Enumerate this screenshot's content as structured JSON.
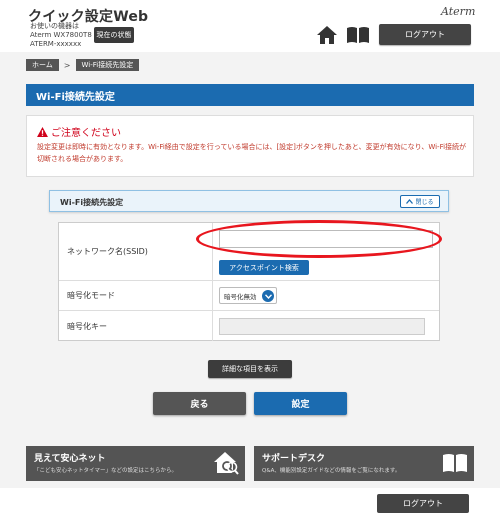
{
  "header": {
    "app_title": "クイック設定Web",
    "device_label": "お使いの機器は",
    "device_model": "Aterm WX7800T8",
    "device_id": "ATERM-xxxxxx",
    "status_button": "現在の状態",
    "brand": "Aterm",
    "logout_label": "ログアウト",
    "home_icon": "home-icon",
    "help_icon": "book-icon"
  },
  "breadcrumb": {
    "items": [
      "ホーム",
      "Wi-Fi接続先設定"
    ],
    "separator": ">"
  },
  "page_title": "Wi-Fi接続先設定",
  "notice": {
    "heading": "ご注意ください",
    "text": "設定変更は即時に有効となります。Wi-Fi経由で設定を行っている場合には、[設定]ボタンを押したあと、変更が有効になり、Wi-Fi接続が切断される場合があります。",
    "color": "#d0021b"
  },
  "section": {
    "title": "Wi-Fi接続先設定",
    "close_label": "閉じる"
  },
  "form": {
    "ssid_label": "ネットワーク名(SSID)",
    "ssid_value": "",
    "ap_search_label": "アクセスポイント検索",
    "encryption_label": "暗号化モード",
    "encryption_value": "暗号化無効",
    "key_label": "暗号化キー",
    "key_value": ""
  },
  "buttons": {
    "show_details": "詳細な項目を表示",
    "back": "戻る",
    "apply": "設定"
  },
  "banners": {
    "left_title": "見えて安心ネット",
    "left_desc": "「こども安心ネットタイマー」などの設定はこちらから。",
    "right_title": "サポートデスク",
    "right_desc": "Q&A、機能別設定ガイドなどの情報をご覧になれます。"
  },
  "footer": {
    "logout_label": "ログアウト"
  },
  "colors": {
    "accent": "#1b6bb0",
    "highlight": "#e8161e",
    "dark_button": "#444444"
  }
}
